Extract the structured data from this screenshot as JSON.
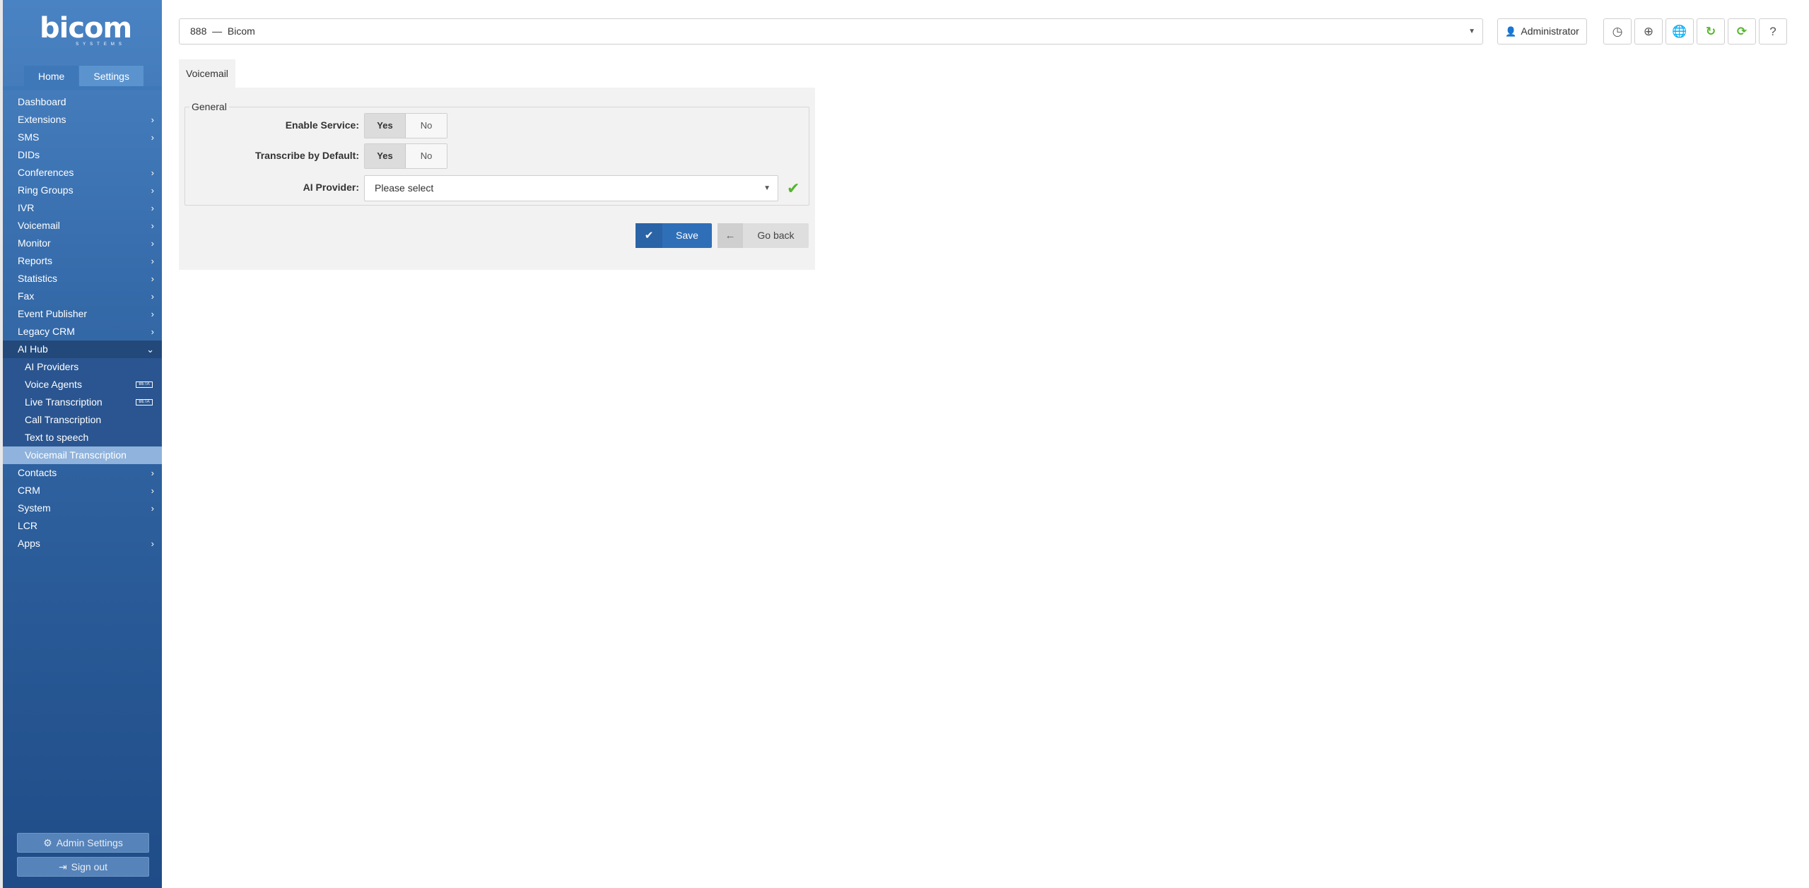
{
  "brand": {
    "logo_text": "bicom",
    "logo_sub": "SYSTEMS"
  },
  "sidebar": {
    "tabs": [
      {
        "label": "Home",
        "active": true
      },
      {
        "label": "Settings",
        "active": false
      }
    ],
    "menu": [
      {
        "label": "Dashboard",
        "arrow": false
      },
      {
        "label": "Extensions",
        "arrow": true
      },
      {
        "label": "SMS",
        "arrow": true
      },
      {
        "label": "DIDs",
        "arrow": false
      },
      {
        "label": "Conferences",
        "arrow": true
      },
      {
        "label": "Ring Groups",
        "arrow": true
      },
      {
        "label": "IVR",
        "arrow": true
      },
      {
        "label": "Voicemail",
        "arrow": true
      },
      {
        "label": "Monitor",
        "arrow": true
      },
      {
        "label": "Reports",
        "arrow": true
      },
      {
        "label": "Statistics",
        "arrow": true
      },
      {
        "label": "Fax",
        "arrow": true
      },
      {
        "label": "Event Publisher",
        "arrow": true
      },
      {
        "label": "Legacy CRM",
        "arrow": true
      },
      {
        "label": "AI Hub",
        "arrow": true,
        "expanded": true
      }
    ],
    "ai_hub_items": [
      {
        "label": "AI Providers",
        "beta": false
      },
      {
        "label": "Voice Agents",
        "beta": true
      },
      {
        "label": "Live Transcription",
        "beta": true
      },
      {
        "label": "Call Transcription",
        "beta": false
      },
      {
        "label": "Text to speech",
        "beta": false
      },
      {
        "label": "Voicemail Transcription",
        "beta": false,
        "active": true
      }
    ],
    "menu_after": [
      {
        "label": "Contacts",
        "arrow": true
      },
      {
        "label": "CRM",
        "arrow": true
      },
      {
        "label": "System",
        "arrow": true
      },
      {
        "label": "LCR",
        "arrow": false
      },
      {
        "label": "Apps",
        "arrow": true
      }
    ],
    "beta_label": "BETA",
    "footer": {
      "admin_settings": "Admin Settings",
      "sign_out": "Sign out"
    }
  },
  "header": {
    "tenant": "888  —  Bicom",
    "user": "Administrator",
    "icons": [
      "clock-icon",
      "globe-grid-icon",
      "language-icon",
      "refresh-icon",
      "sync-icon",
      "help-icon"
    ]
  },
  "content": {
    "tab": "Voicemail",
    "legend": "General",
    "enable_service": {
      "label": "Enable Service:",
      "yes": "Yes",
      "no": "No",
      "value": "Yes"
    },
    "transcribe_default": {
      "label": "Transcribe by Default:",
      "yes": "Yes",
      "no": "No",
      "value": "Yes"
    },
    "ai_provider": {
      "label": "AI Provider:",
      "value": "Please select"
    },
    "save_label": "Save",
    "back_label": "Go back"
  },
  "colors": {
    "sidebar_top": "#4a83c3",
    "sidebar_bottom": "#1f4c87",
    "accent": "#2f6fb8",
    "valid": "#55b52d"
  }
}
